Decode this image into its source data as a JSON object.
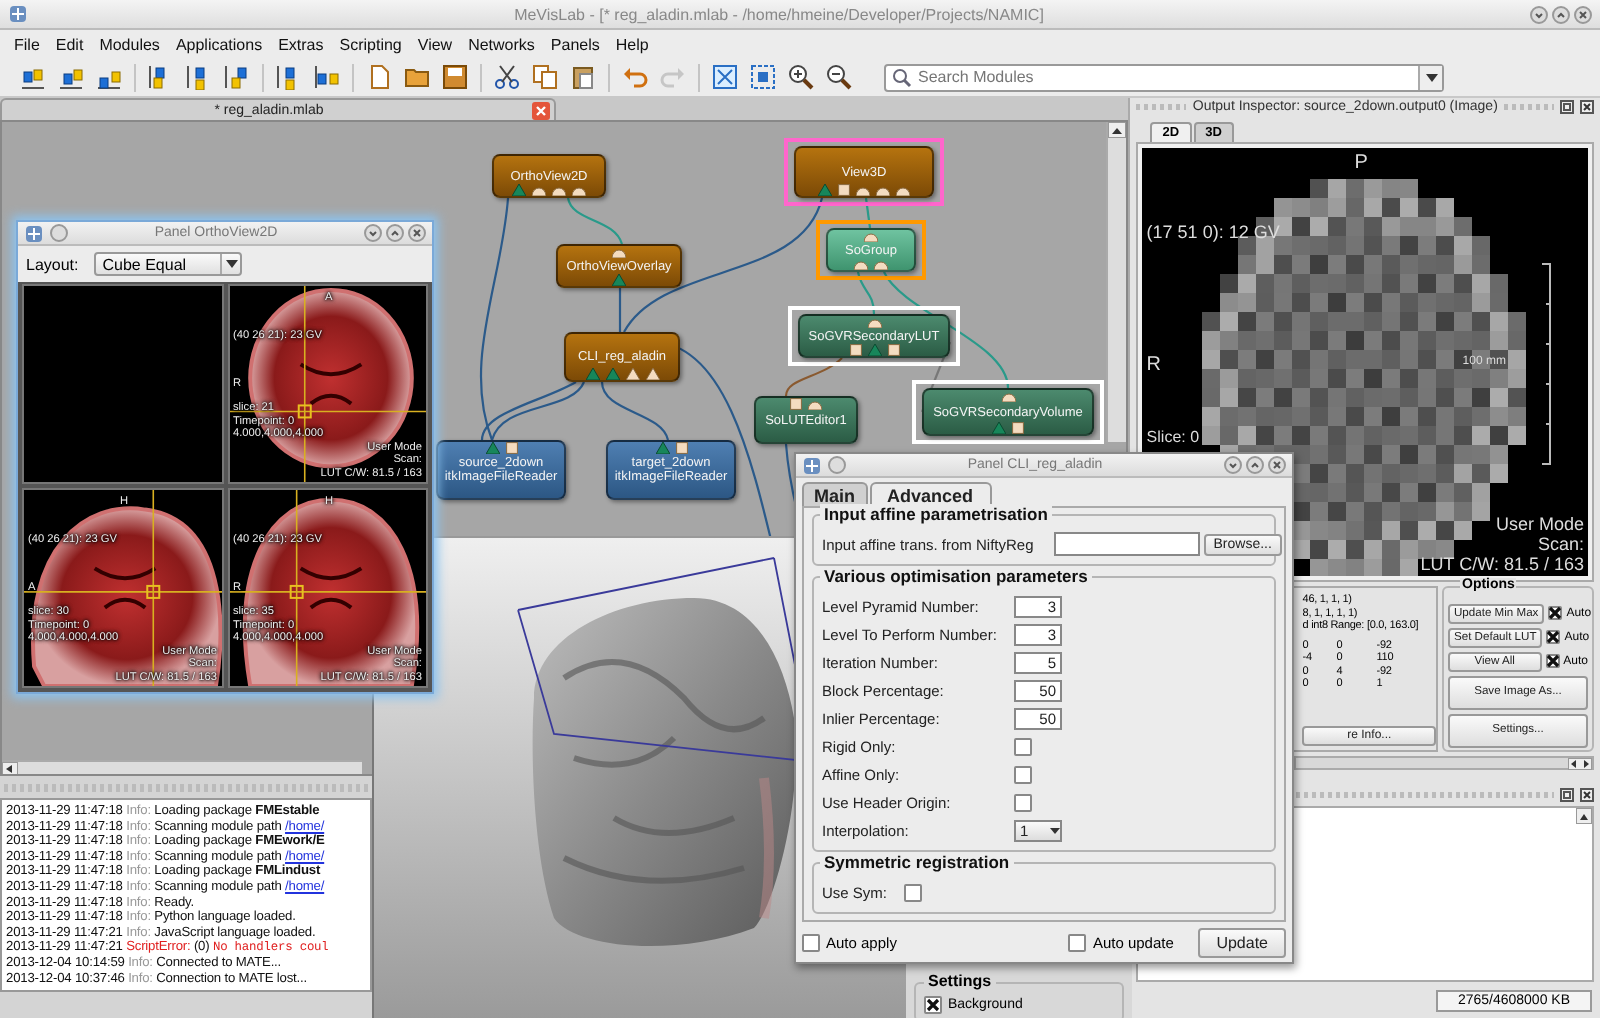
{
  "window": {
    "title": "MeVisLab - [* reg_aladin.mlab - /home/hmeine/Developer/Projects/NAMIC]"
  },
  "menu": [
    "File",
    "Edit",
    "Modules",
    "Applications",
    "Extras",
    "Scripting",
    "View",
    "Networks",
    "Panels",
    "Help"
  ],
  "toolbar": {
    "redo_enabled": false,
    "search": {
      "placeholder": "Search Modules"
    }
  },
  "network": {
    "tab": "* reg_aladin.mlab",
    "nodes": [
      {
        "kind": "macro",
        "name": "OrthoView2D"
      },
      {
        "kind": "macro",
        "name": "OrthoViewOverlay"
      },
      {
        "kind": "macro",
        "name": "CLI_reg_aladin"
      },
      {
        "kind": "module",
        "name": "source_2down",
        "type": "itkImageFileReader"
      },
      {
        "kind": "module",
        "name": "target_2down",
        "type": "itkImageFileReader"
      },
      {
        "kind": "macro",
        "name": "View3D",
        "color": "#ff66cc"
      },
      {
        "kind": "group",
        "name": "SoGroup",
        "color": "#ff9900"
      },
      {
        "kind": "inventor",
        "name": "SoGVRSecondaryLUT",
        "color": "#ffffff"
      },
      {
        "kind": "inventor",
        "name": "SoLUTEditor1"
      },
      {
        "kind": "inventor",
        "name": "SoGVRSecondaryVolume",
        "color": "#ffffff"
      }
    ]
  },
  "ortho_panel": {
    "title": "Panel OrthoView2D",
    "layout_label": "Layout:",
    "layout_value": "Cube Equal",
    "views": [
      {
        "kind": "empty"
      },
      {
        "kind": "axial",
        "top": "A",
        "side": "R",
        "position": "(40 26 21): 23 GV",
        "info": [
          "slice: 21",
          "Timepoint: 0",
          "4.000,4.000,4.000"
        ],
        "mode": [
          "User Mode",
          "Scan:",
          "LUT C/W: 81.5 / 163"
        ]
      },
      {
        "kind": "sagittal",
        "top": "H",
        "side": "A",
        "position": "(40 26 21): 23 GV",
        "info": [
          "slice: 30",
          "Timepoint: 0",
          "4.000,4.000,4.000"
        ],
        "mode": [
          "User Mode",
          "Scan:",
          "LUT C/W: 81.5 / 163"
        ]
      },
      {
        "kind": "coronal",
        "top": "H",
        "side": "R",
        "position": "(40 26 21): 23 GV",
        "info": [
          "slice: 35",
          "Timepoint: 0",
          "4.000,4.000,4.000"
        ],
        "mode": [
          "User Mode",
          "Scan:",
          "LUT C/W: 81.5 / 163"
        ]
      }
    ]
  },
  "log": [
    {
      "time": "2013-11-29 11:47:18",
      "kind": "info",
      "level": "Info:",
      "message": "Loading package **FMEstable**"
    },
    {
      "time": "2013-11-29 11:47:18",
      "kind": "info",
      "level": "Info:",
      "message": "Scanning module path",
      "link": "/home/"
    },
    {
      "time": "2013-11-29 11:47:18",
      "kind": "info",
      "level": "Info:",
      "message": "Loading package **FMEwork/E**"
    },
    {
      "time": "2013-11-29 11:47:18",
      "kind": "info",
      "level": "Info:",
      "message": "Scanning module path",
      "link": "/home/"
    },
    {
      "time": "2013-11-29 11:47:18",
      "kind": "info",
      "level": "Info:",
      "message": "Loading package **FMLindust**"
    },
    {
      "time": "2013-11-29 11:47:18",
      "kind": "info",
      "level": "Info:",
      "message": "Scanning module path",
      "link": "/home/"
    },
    {
      "time": "2013-11-29 11:47:18",
      "kind": "info",
      "level": "Info:",
      "message": "Ready."
    },
    {
      "time": "2013-11-29 11:47:18",
      "kind": "info",
      "level": "Info:",
      "message": "Python language loaded."
    },
    {
      "time": "2013-11-29 11:47:21",
      "kind": "info",
      "level": "Info:",
      "message": "JavaScript language loaded."
    },
    {
      "time": "2013-11-29 11:47:21",
      "kind": "error",
      "level": "ScriptError:",
      "message": "(0)",
      "code": "No handlers coul"
    },
    {
      "time": "2013-12-04 10:14:59",
      "kind": "info",
      "level": "Info:",
      "message": "Connected to MATE..."
    },
    {
      "time": "2013-12-04 10:37:46",
      "kind": "info",
      "level": "Info:",
      "message": "Connection to MATE lost..."
    }
  ],
  "view3d": {
    "settings": {
      "title": "Settings",
      "checkboxes": [
        {
          "label": "Background",
          "checked": true
        }
      ]
    }
  },
  "cli_panel": {
    "title": "Panel CLI_reg_aladin",
    "tabs": [
      {
        "label": "Main",
        "selected": false
      },
      {
        "label": "Advanced",
        "selected": true
      }
    ],
    "groups": [
      {
        "title": "Input affine parametrisation",
        "rows": [
          {
            "kind": "file",
            "label": "Input affine trans. from NiftyReg",
            "button": "Browse..."
          }
        ]
      },
      {
        "title": "Various optimisation parameters",
        "rows": [
          {
            "kind": "number",
            "label": "Level Pyramid Number:",
            "value": "3"
          },
          {
            "kind": "number",
            "label": "Level To Perform Number:",
            "value": "3"
          },
          {
            "kind": "number",
            "label": "Iteration Number:",
            "value": "5"
          },
          {
            "kind": "number",
            "label": "Block Percentage:",
            "value": "50"
          },
          {
            "kind": "number",
            "label": "Inlier Percentage:",
            "value": "50"
          },
          {
            "kind": "checkbox",
            "label": "Rigid Only:",
            "checked": false
          },
          {
            "kind": "checkbox",
            "label": "Affine Only:",
            "checked": false
          },
          {
            "kind": "checkbox",
            "label": "Use Header Origin:",
            "checked": false
          },
          {
            "kind": "combo",
            "label": "Interpolation:",
            "value": "1"
          }
        ]
      },
      {
        "title": "Symmetric registration",
        "rows": [
          {
            "kind": "checkbox",
            "label": "Use Sym:",
            "checked": false
          }
        ]
      }
    ],
    "auto_apply": {
      "label": "Auto apply",
      "checked": false
    },
    "auto_update": {
      "label": "Auto update",
      "checked": false
    },
    "button": "Update"
  },
  "inspector": {
    "title": "Output Inspector: source_2down.output0 (Image)",
    "tabs": [
      {
        "label": "2D",
        "selected": true
      },
      {
        "label": "3D",
        "selected": false
      }
    ],
    "view": {
      "top": "P",
      "position": "(17 51 0): 12 GV",
      "side": "R",
      "scale": "100 mm",
      "slice": "Slice: 0",
      "mode": [
        "User Mode",
        "Scan:",
        "LUT C/W: 81.5 / 163"
      ]
    },
    "info": [
      "46, 1, 1, 1)",
      "8, 1, 1, 1, 1)",
      "d int8  Range: [0.0, 163.0]"
    ],
    "matrix": [
      [
        "0",
        "0",
        "-92"
      ],
      [
        "-4",
        "0",
        "110"
      ],
      [
        "0",
        "4",
        "-92"
      ],
      [
        "0",
        "0",
        "1"
      ]
    ],
    "info_button": "re Info...",
    "options": {
      "title": "Options",
      "rows": [
        {
          "button": "Update Min Max",
          "label": "Auto",
          "checked": true
        },
        {
          "button": "Set Default LUT",
          "label": "Auto",
          "checked": true
        },
        {
          "button": "View All",
          "label": "Auto",
          "checked": true
        }
      ],
      "buttons": [
        "Save Image As...",
        "Settings..."
      ]
    }
  },
  "status": {
    "memory": "2765/4608000 KB"
  }
}
